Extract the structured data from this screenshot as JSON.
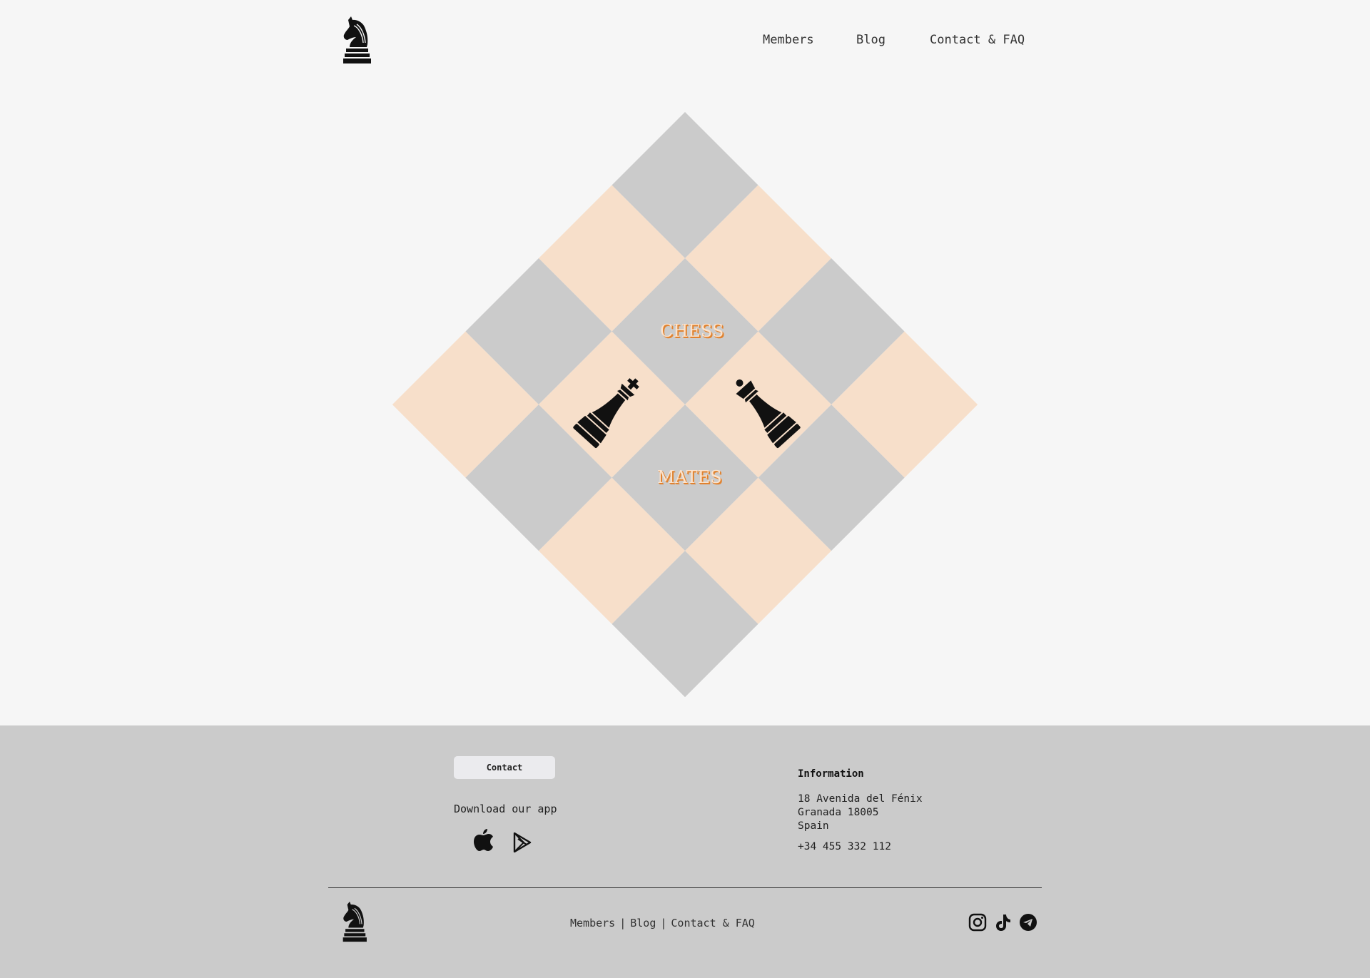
{
  "header": {
    "nav": [
      "Members",
      "Blog",
      "Contact & FAQ"
    ]
  },
  "hero": {
    "word_top": "CHESS",
    "word_bottom": "MATES"
  },
  "colors": {
    "page_bg": "#f6f6f6",
    "tile_gray": "#cbcbcb",
    "tile_peach": "#f7dfca",
    "text_orange": "#e0822f",
    "footer_bg": "#cbcbcb"
  },
  "footer": {
    "contact_button": "Contact",
    "download_label": "Download our app",
    "store_icons": [
      "apple-icon",
      "google-play-icon"
    ],
    "info": {
      "title": "Information",
      "address_line1": "18 Avenida del Fénix",
      "address_line2": "Granada 18005",
      "address_line3": "Spain",
      "phone": "+34 455 332 112"
    },
    "links": [
      "Members",
      "Blog",
      "Contact & FAQ"
    ],
    "social_icons": [
      "instagram-icon",
      "tiktok-icon",
      "telegram-icon"
    ]
  }
}
